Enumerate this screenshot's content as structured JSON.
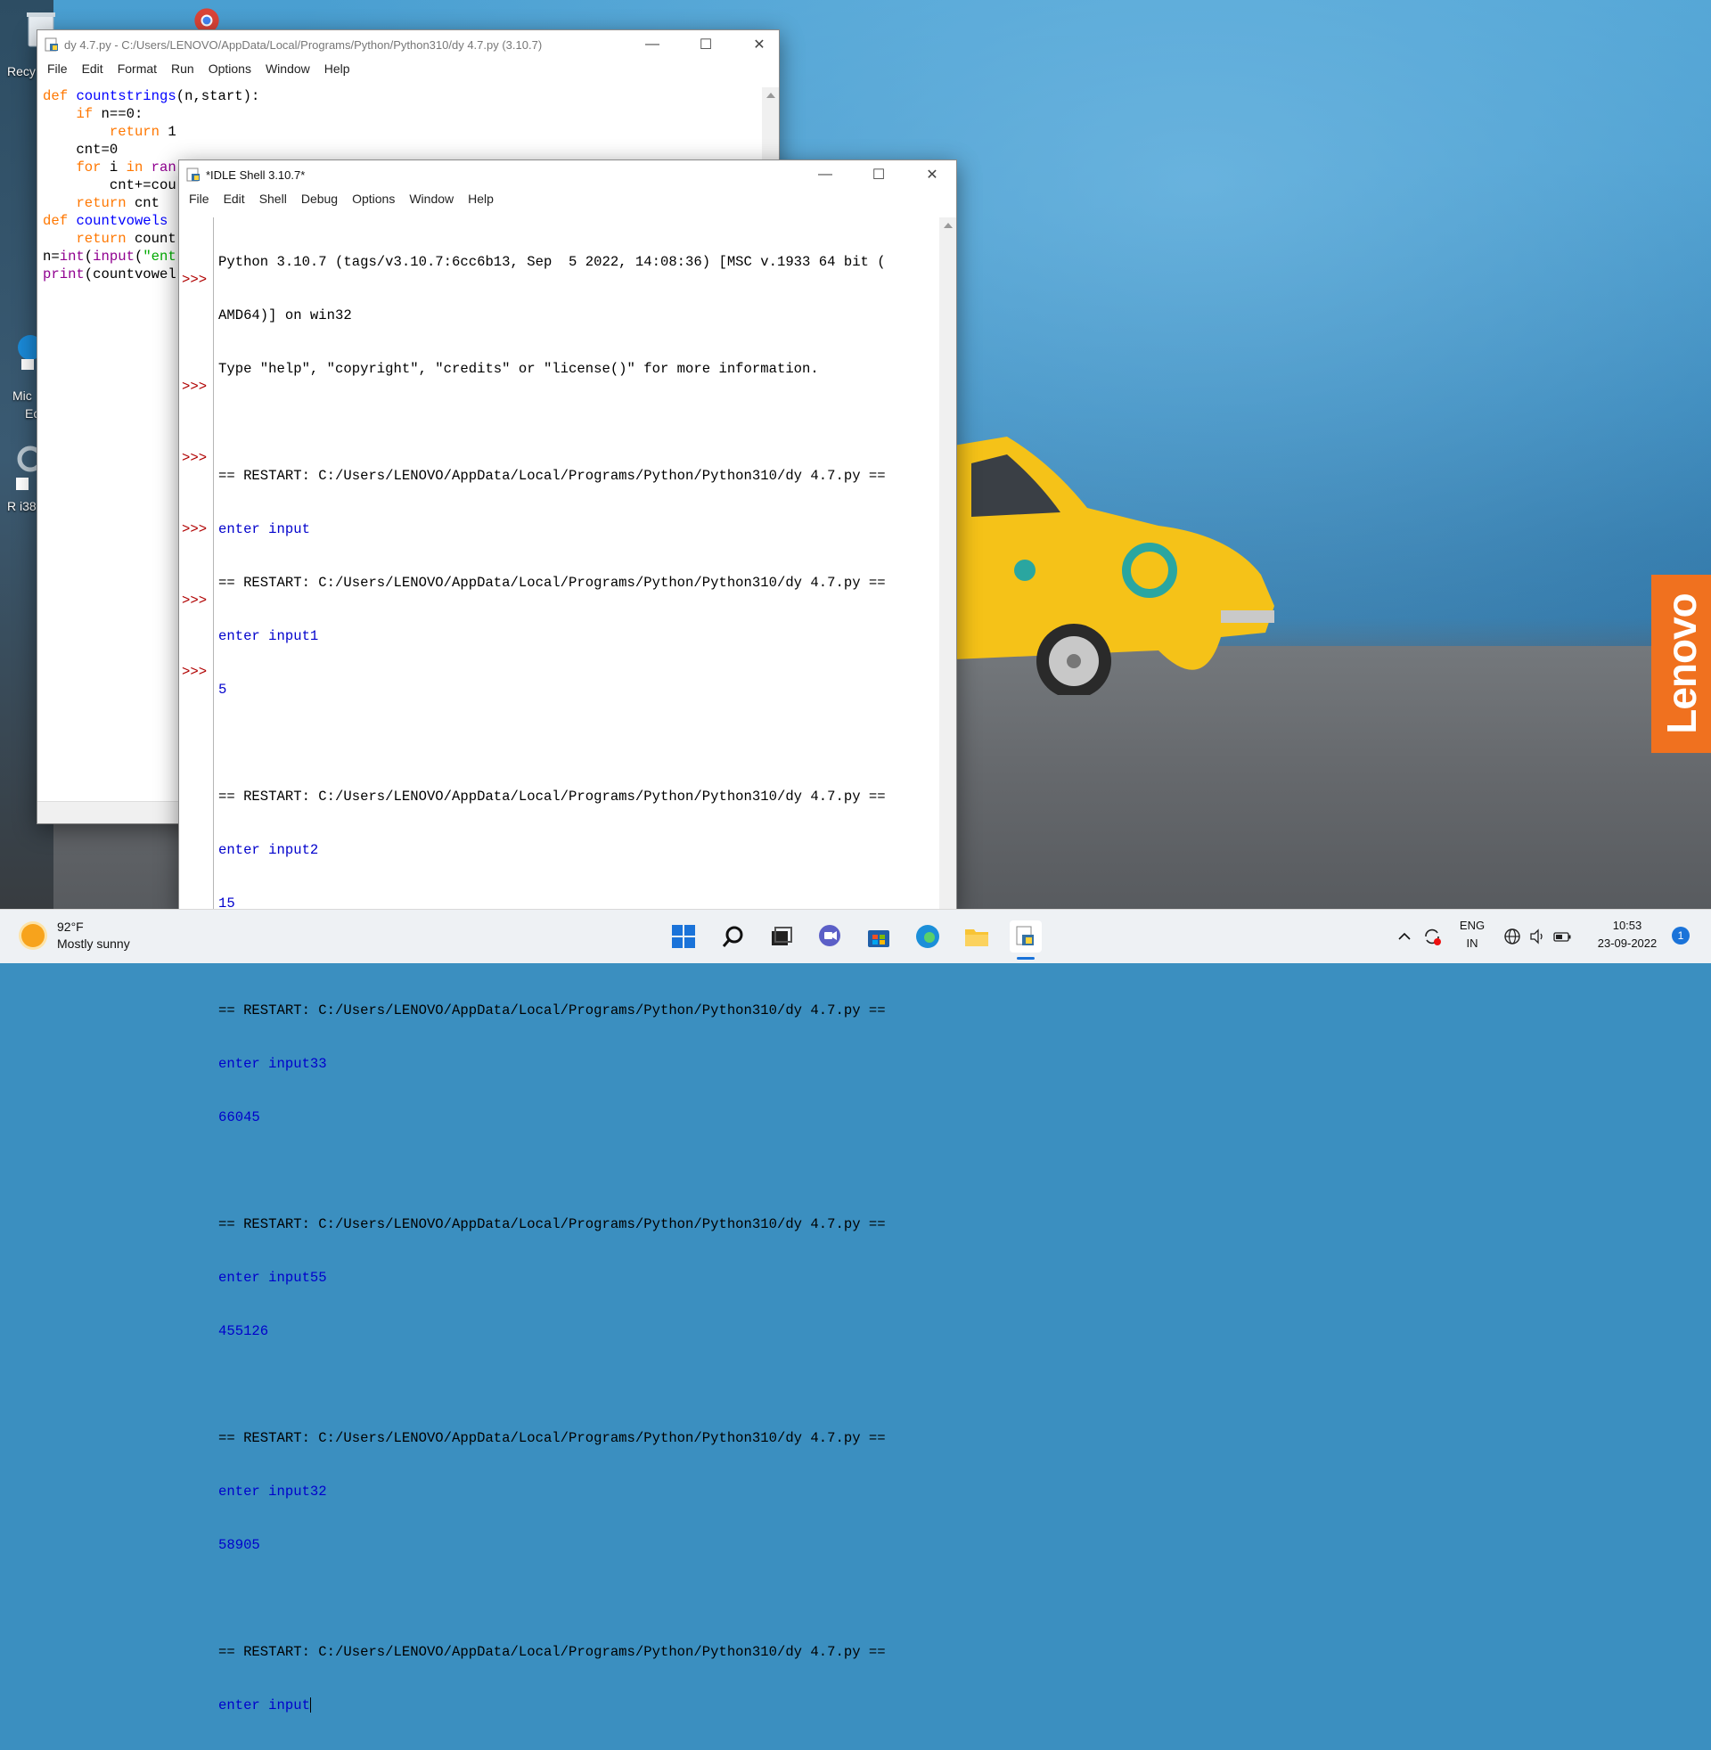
{
  "desktop": {
    "icons": [
      {
        "label": "Recy"
      },
      {
        "label": "Mic"
      },
      {
        "label": "Ec"
      },
      {
        "label": "R i38"
      }
    ],
    "brand": "Lenovo"
  },
  "editor": {
    "title": "dy 4.7.py - C:/Users/LENOVO/AppData/Local/Programs/Python/Python310/dy 4.7.py (3.10.7)",
    "menu": [
      "File",
      "Edit",
      "Format",
      "Run",
      "Options",
      "Window",
      "Help"
    ]
  },
  "shell": {
    "title": "*IDLE Shell 3.10.7*",
    "menu": [
      "File",
      "Edit",
      "Shell",
      "Debug",
      "Options",
      "Window",
      "Help"
    ],
    "banner": [
      "Python 3.10.7 (tags/v3.10.7:6cc6b13, Sep  5 2022, 14:08:36) [MSC v.1933 64 bit (",
      "AMD64)] on win32",
      "Type \"help\", \"copyright\", \"credits\" or \"license()\" for more information."
    ],
    "prompt": ">>>",
    "restart_line": "== RESTART: C:/Users/LENOVO/AppData/Local/Programs/Python/Python310/dy 4.7.py ==",
    "runs": [
      {
        "input_line": "enter input",
        "output": ""
      },
      {
        "input_line": "enter input1",
        "output": "5"
      },
      {
        "input_line": "enter input2",
        "output": "15"
      },
      {
        "input_line": "enter input33",
        "output": "66045"
      },
      {
        "input_line": "enter input55",
        "output": "455126"
      },
      {
        "input_line": "enter input32",
        "output": "58905"
      },
      {
        "input_line": "enter input",
        "output": ""
      }
    ]
  },
  "taskbar": {
    "weather_temp": "92°F",
    "weather_desc": "Mostly sunny",
    "lang_top": "ENG",
    "lang_bottom": "IN",
    "time": "10:53",
    "date": "23-09-2022",
    "notification_count": "1"
  }
}
